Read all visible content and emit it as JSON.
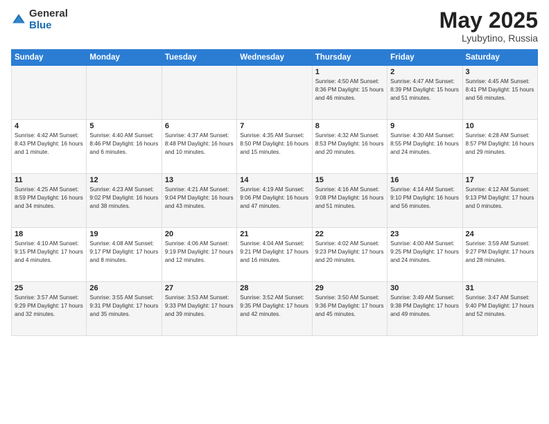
{
  "header": {
    "logo_general": "General",
    "logo_blue": "Blue",
    "title": "May 2025",
    "location": "Lyubytino, Russia"
  },
  "days_of_week": [
    "Sunday",
    "Monday",
    "Tuesday",
    "Wednesday",
    "Thursday",
    "Friday",
    "Saturday"
  ],
  "weeks": [
    [
      {
        "day": "",
        "content": ""
      },
      {
        "day": "",
        "content": ""
      },
      {
        "day": "",
        "content": ""
      },
      {
        "day": "",
        "content": ""
      },
      {
        "day": "1",
        "content": "Sunrise: 4:50 AM\nSunset: 8:36 PM\nDaylight: 15 hours\nand 46 minutes."
      },
      {
        "day": "2",
        "content": "Sunrise: 4:47 AM\nSunset: 8:39 PM\nDaylight: 15 hours\nand 51 minutes."
      },
      {
        "day": "3",
        "content": "Sunrise: 4:45 AM\nSunset: 8:41 PM\nDaylight: 15 hours\nand 56 minutes."
      }
    ],
    [
      {
        "day": "4",
        "content": "Sunrise: 4:42 AM\nSunset: 8:43 PM\nDaylight: 16 hours\nand 1 minute."
      },
      {
        "day": "5",
        "content": "Sunrise: 4:40 AM\nSunset: 8:46 PM\nDaylight: 16 hours\nand 6 minutes."
      },
      {
        "day": "6",
        "content": "Sunrise: 4:37 AM\nSunset: 8:48 PM\nDaylight: 16 hours\nand 10 minutes."
      },
      {
        "day": "7",
        "content": "Sunrise: 4:35 AM\nSunset: 8:50 PM\nDaylight: 16 hours\nand 15 minutes."
      },
      {
        "day": "8",
        "content": "Sunrise: 4:32 AM\nSunset: 8:53 PM\nDaylight: 16 hours\nand 20 minutes."
      },
      {
        "day": "9",
        "content": "Sunrise: 4:30 AM\nSunset: 8:55 PM\nDaylight: 16 hours\nand 24 minutes."
      },
      {
        "day": "10",
        "content": "Sunrise: 4:28 AM\nSunset: 8:57 PM\nDaylight: 16 hours\nand 29 minutes."
      }
    ],
    [
      {
        "day": "11",
        "content": "Sunrise: 4:25 AM\nSunset: 8:59 PM\nDaylight: 16 hours\nand 34 minutes."
      },
      {
        "day": "12",
        "content": "Sunrise: 4:23 AM\nSunset: 9:02 PM\nDaylight: 16 hours\nand 38 minutes."
      },
      {
        "day": "13",
        "content": "Sunrise: 4:21 AM\nSunset: 9:04 PM\nDaylight: 16 hours\nand 43 minutes."
      },
      {
        "day": "14",
        "content": "Sunrise: 4:19 AM\nSunset: 9:06 PM\nDaylight: 16 hours\nand 47 minutes."
      },
      {
        "day": "15",
        "content": "Sunrise: 4:16 AM\nSunset: 9:08 PM\nDaylight: 16 hours\nand 51 minutes."
      },
      {
        "day": "16",
        "content": "Sunrise: 4:14 AM\nSunset: 9:10 PM\nDaylight: 16 hours\nand 56 minutes."
      },
      {
        "day": "17",
        "content": "Sunrise: 4:12 AM\nSunset: 9:13 PM\nDaylight: 17 hours\nand 0 minutes."
      }
    ],
    [
      {
        "day": "18",
        "content": "Sunrise: 4:10 AM\nSunset: 9:15 PM\nDaylight: 17 hours\nand 4 minutes."
      },
      {
        "day": "19",
        "content": "Sunrise: 4:08 AM\nSunset: 9:17 PM\nDaylight: 17 hours\nand 8 minutes."
      },
      {
        "day": "20",
        "content": "Sunrise: 4:06 AM\nSunset: 9:19 PM\nDaylight: 17 hours\nand 12 minutes."
      },
      {
        "day": "21",
        "content": "Sunrise: 4:04 AM\nSunset: 9:21 PM\nDaylight: 17 hours\nand 16 minutes."
      },
      {
        "day": "22",
        "content": "Sunrise: 4:02 AM\nSunset: 9:23 PM\nDaylight: 17 hours\nand 20 minutes."
      },
      {
        "day": "23",
        "content": "Sunrise: 4:00 AM\nSunset: 9:25 PM\nDaylight: 17 hours\nand 24 minutes."
      },
      {
        "day": "24",
        "content": "Sunrise: 3:59 AM\nSunset: 9:27 PM\nDaylight: 17 hours\nand 28 minutes."
      }
    ],
    [
      {
        "day": "25",
        "content": "Sunrise: 3:57 AM\nSunset: 9:29 PM\nDaylight: 17 hours\nand 32 minutes."
      },
      {
        "day": "26",
        "content": "Sunrise: 3:55 AM\nSunset: 9:31 PM\nDaylight: 17 hours\nand 35 minutes."
      },
      {
        "day": "27",
        "content": "Sunrise: 3:53 AM\nSunset: 9:33 PM\nDaylight: 17 hours\nand 39 minutes."
      },
      {
        "day": "28",
        "content": "Sunrise: 3:52 AM\nSunset: 9:35 PM\nDaylight: 17 hours\nand 42 minutes."
      },
      {
        "day": "29",
        "content": "Sunrise: 3:50 AM\nSunset: 9:36 PM\nDaylight: 17 hours\nand 45 minutes."
      },
      {
        "day": "30",
        "content": "Sunrise: 3:49 AM\nSunset: 9:38 PM\nDaylight: 17 hours\nand 49 minutes."
      },
      {
        "day": "31",
        "content": "Sunrise: 3:47 AM\nSunset: 9:40 PM\nDaylight: 17 hours\nand 52 minutes."
      }
    ]
  ]
}
